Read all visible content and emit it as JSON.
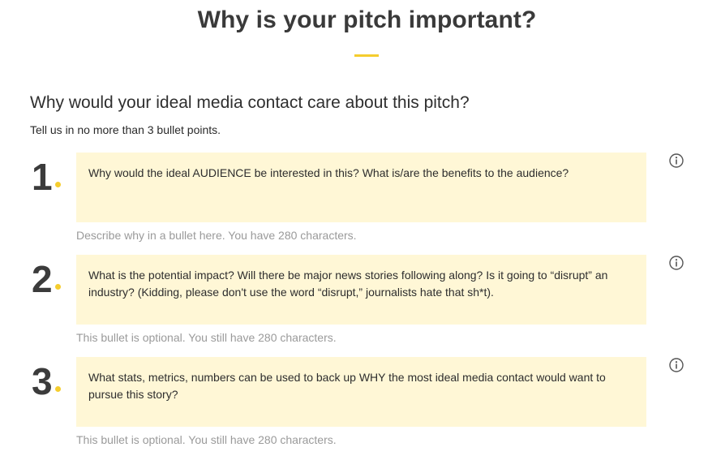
{
  "page": {
    "title": "Why is your pitch important?",
    "accent_color": "#f5cd2e",
    "box_color": "#fff7d6"
  },
  "section": {
    "heading": "Why would your ideal media contact care about this pitch?",
    "subheading": "Tell us in no more than 3 bullet points."
  },
  "bullets": [
    {
      "number": "1",
      "prompt": "Why would the ideal AUDIENCE be interested in this? What is/are the benefits to the audience?",
      "hint": "Describe why in a bullet here. You have 280 characters.",
      "icon": "info-icon"
    },
    {
      "number": "2",
      "prompt": "What is the potential impact? Will there be major news stories following along? Is it going to “disrupt” an industry? (Kidding, please don't use the word “disrupt,” journalists hate that sh*t).",
      "hint": "This bullet is optional. You still have 280 characters.",
      "icon": "info-icon"
    },
    {
      "number": "3",
      "prompt": "What stats, metrics, numbers can be used to back up WHY the most ideal media contact would want to pursue this story?",
      "hint": "This bullet is optional. You still have 280 characters.",
      "icon": "info-icon"
    }
  ]
}
